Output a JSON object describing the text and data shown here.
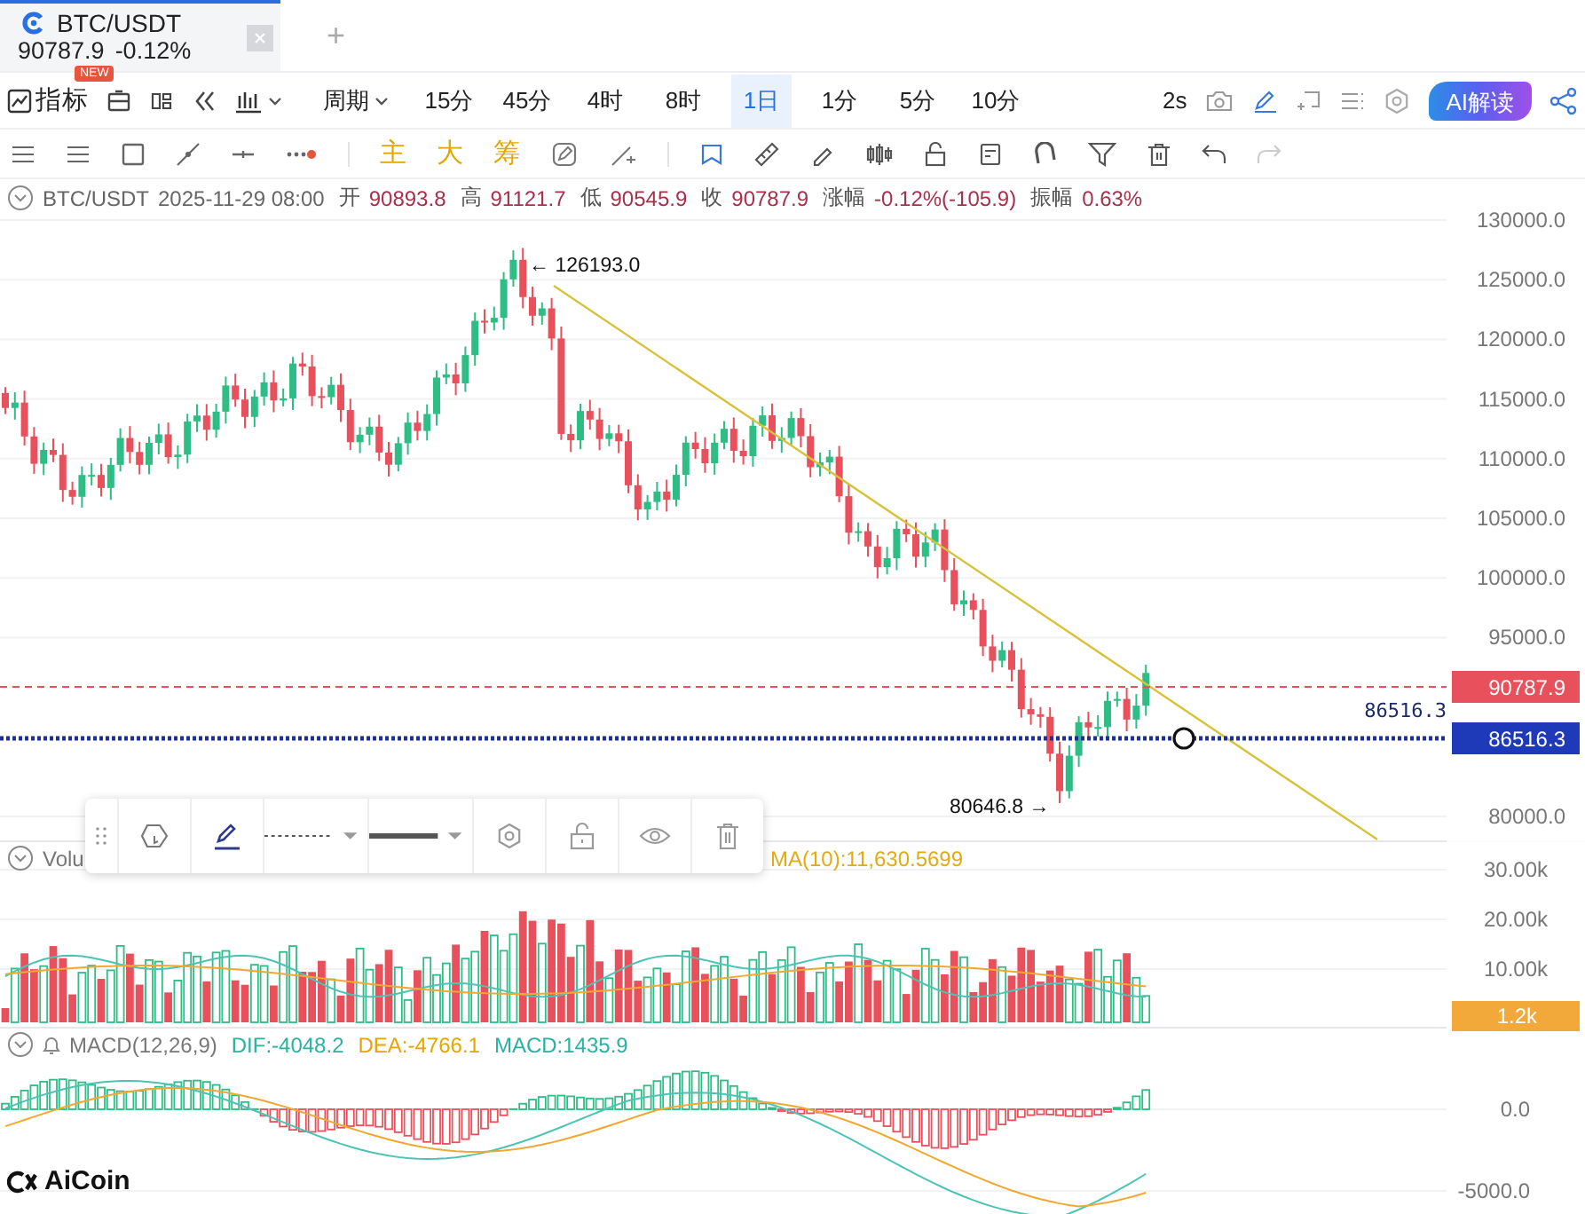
{
  "tabs": [
    {
      "symbol": "BTC/USDT",
      "price": "90787.9",
      "change": "-0.12%",
      "selected": true
    }
  ],
  "new_tab": "+",
  "toolbar": {
    "indicators": "指标",
    "badge": "NEW",
    "period": "周期",
    "intervals": [
      {
        "label": "15分",
        "selected": false
      },
      {
        "label": "45分",
        "selected": false
      },
      {
        "label": "4时",
        "selected": false
      },
      {
        "label": "8时",
        "selected": false
      },
      {
        "label": "1日",
        "selected": true
      },
      {
        "label": "1分",
        "selected": false
      },
      {
        "label": "5分",
        "selected": false
      },
      {
        "label": "10分",
        "selected": false
      }
    ],
    "refresh": "2s",
    "ai_button": "AI解读"
  },
  "draw_toolbar": {
    "text_tools": [
      "主",
      "大",
      "筹"
    ]
  },
  "info": {
    "symbol": "BTC/USDT",
    "time": "2025-11-29 08:00",
    "fields": [
      {
        "label": "开",
        "value": "90893.8"
      },
      {
        "label": "高",
        "value": "91121.7"
      },
      {
        "label": "低",
        "value": "90545.9"
      },
      {
        "label": "收",
        "value": "90787.9"
      },
      {
        "label": "涨幅",
        "value": "-0.12%(-105.9)"
      },
      {
        "label": "振幅",
        "value": "0.63%"
      }
    ]
  },
  "price_chart": {
    "high_label": "← 126193.0",
    "low_label": "80646.8 →",
    "axis_ticks": [
      "130000.0",
      "125000.0",
      "120000.0",
      "115000.0",
      "110000.0",
      "105000.0",
      "100000.0",
      "95000.0",
      "80000.0"
    ],
    "last_price": "90787.9",
    "line_label": "86516.3",
    "line_price": "86516.3"
  },
  "volume": {
    "title": "Volu",
    "ma": "MA(10):11,630.5699",
    "axis_ticks": [
      "30.00k",
      "20.00k",
      "10.00k"
    ],
    "current": "1.2k"
  },
  "macd": {
    "title": "MACD(12,26,9)",
    "dif": "DIF:-4048.2",
    "dea": "DEA:-4766.1",
    "macd": "MACD:1435.9",
    "axis_ticks": [
      "0.0",
      "-5000.0"
    ]
  },
  "logo": "AiCoin"
}
